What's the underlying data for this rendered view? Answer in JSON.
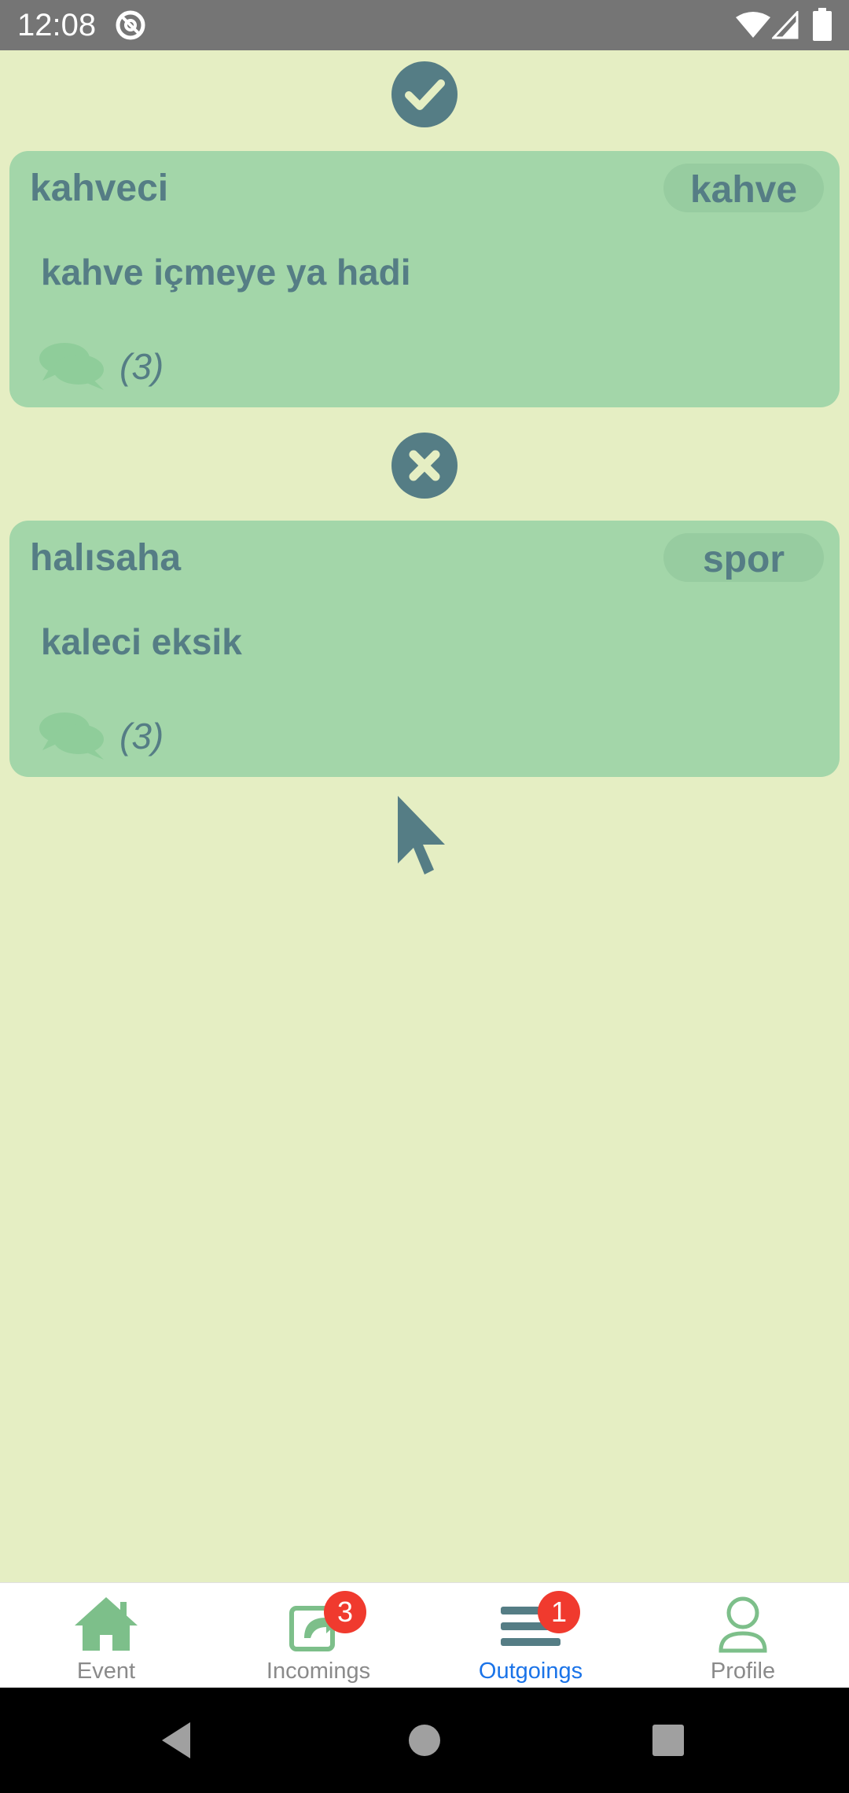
{
  "status_bar": {
    "time": "12:08"
  },
  "events": [
    {
      "status": "accepted",
      "status_icon": "check-circle-icon",
      "title": "kahveci",
      "tag": "kahve",
      "description": "kahve içmeye ya hadi",
      "comments": "(3)"
    },
    {
      "status": "rejected",
      "status_icon": "x-circle-icon",
      "title": "halısaha",
      "tag": "spor",
      "description": "kaleci eksik",
      "comments": "(3)"
    }
  ],
  "bottom_nav": {
    "items": [
      {
        "label": "Event",
        "icon": "home-icon",
        "active": false
      },
      {
        "label": "Incomings",
        "icon": "incoming-icon",
        "badge": "3",
        "active": false
      },
      {
        "label": "Outgoings",
        "icon": "list-icon",
        "badge": "1",
        "active": true
      },
      {
        "label": "Profile",
        "icon": "person-icon",
        "active": false
      }
    ]
  },
  "colors": {
    "background": "#e5eec3",
    "card": "#a3d6a9",
    "text": "#557d85",
    "active_nav": "#1a73e8",
    "badge": "#f03a2e"
  }
}
